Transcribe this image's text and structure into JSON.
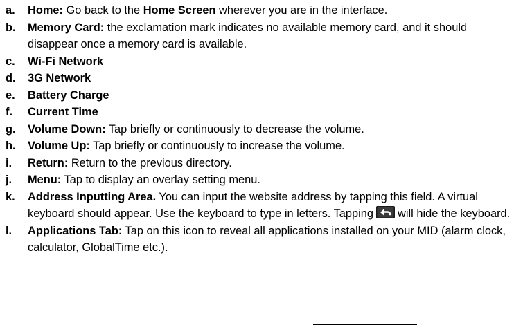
{
  "items": [
    {
      "letter": "a.",
      "term": "Home:",
      "parts": [
        " Go back to the ",
        "Home Screen",
        " wherever you are in the interface."
      ]
    },
    {
      "letter": "b.",
      "term": "Memory Card:",
      "text": " the exclamation mark indicates no available memory card, and it should disappear once a memory card is available."
    },
    {
      "letter": "c.",
      "term": "Wi-Fi Network"
    },
    {
      "letter": "d.",
      "term": "3G Network"
    },
    {
      "letter": "e.",
      "term": "Battery Charge"
    },
    {
      "letter": "f.",
      "term": "Current Time"
    },
    {
      "letter": "g.",
      "term": "Volume Down:",
      "text": " Tap briefly or continuously to decrease the volume."
    },
    {
      "letter": "h.",
      "term": "Volume Up:",
      "text": " Tap briefly or continuously to increase the volume."
    },
    {
      "letter": "i.",
      "term": "Return:",
      "text": " Return to the previous directory."
    },
    {
      "letter": "j.",
      "term": "Menu:",
      "text": " Tap to display an overlay setting menu."
    },
    {
      "letter": "k.",
      "term": "Address Inputting Area.",
      "text_before_icon": " You can input the website address by tapping this field. A virtual keyboard should appear. Use the keyboard to type in letters. Tapping",
      "icon": "keyboard-hide-icon",
      "text_after_icon": "will hide the keyboard."
    },
    {
      "letter": "l.",
      "term": "Applications Tab:",
      "text": " Tap on this icon to reveal all applications installed on your MID (alarm clock, calculator, GlobalTime etc.)."
    }
  ]
}
